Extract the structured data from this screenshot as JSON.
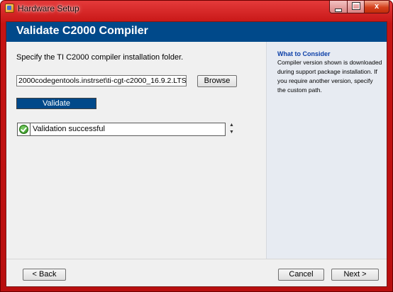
{
  "window": {
    "title": "Hardware Setup",
    "controls": {
      "minimize": "minimize",
      "maximize": "maximize",
      "close": "x"
    }
  },
  "header": {
    "title": "Validate C2000 Compiler"
  },
  "main": {
    "instruction": "Specify the TI C2000 compiler installation folder.",
    "path_value": "2000codegentools.instrset\\ti-cgt-c2000_16.9.2.LTS",
    "browse_label": "Browse",
    "validate_label": "Validate",
    "result": {
      "text": "Validation successful",
      "status_icon": "check-circle-icon"
    }
  },
  "side": {
    "heading": "What to Consider",
    "body": "Compiler version shown is downloaded during support package installation. If you require another version, specify the custom path."
  },
  "footer": {
    "back_label": "< Back",
    "cancel_label": "Cancel",
    "next_label": "Next >"
  },
  "colors": {
    "header_bg": "#00498a",
    "title_bar": "#c61414",
    "side_bg": "#e7ebf2",
    "side_heading": "#0b3fa8"
  }
}
